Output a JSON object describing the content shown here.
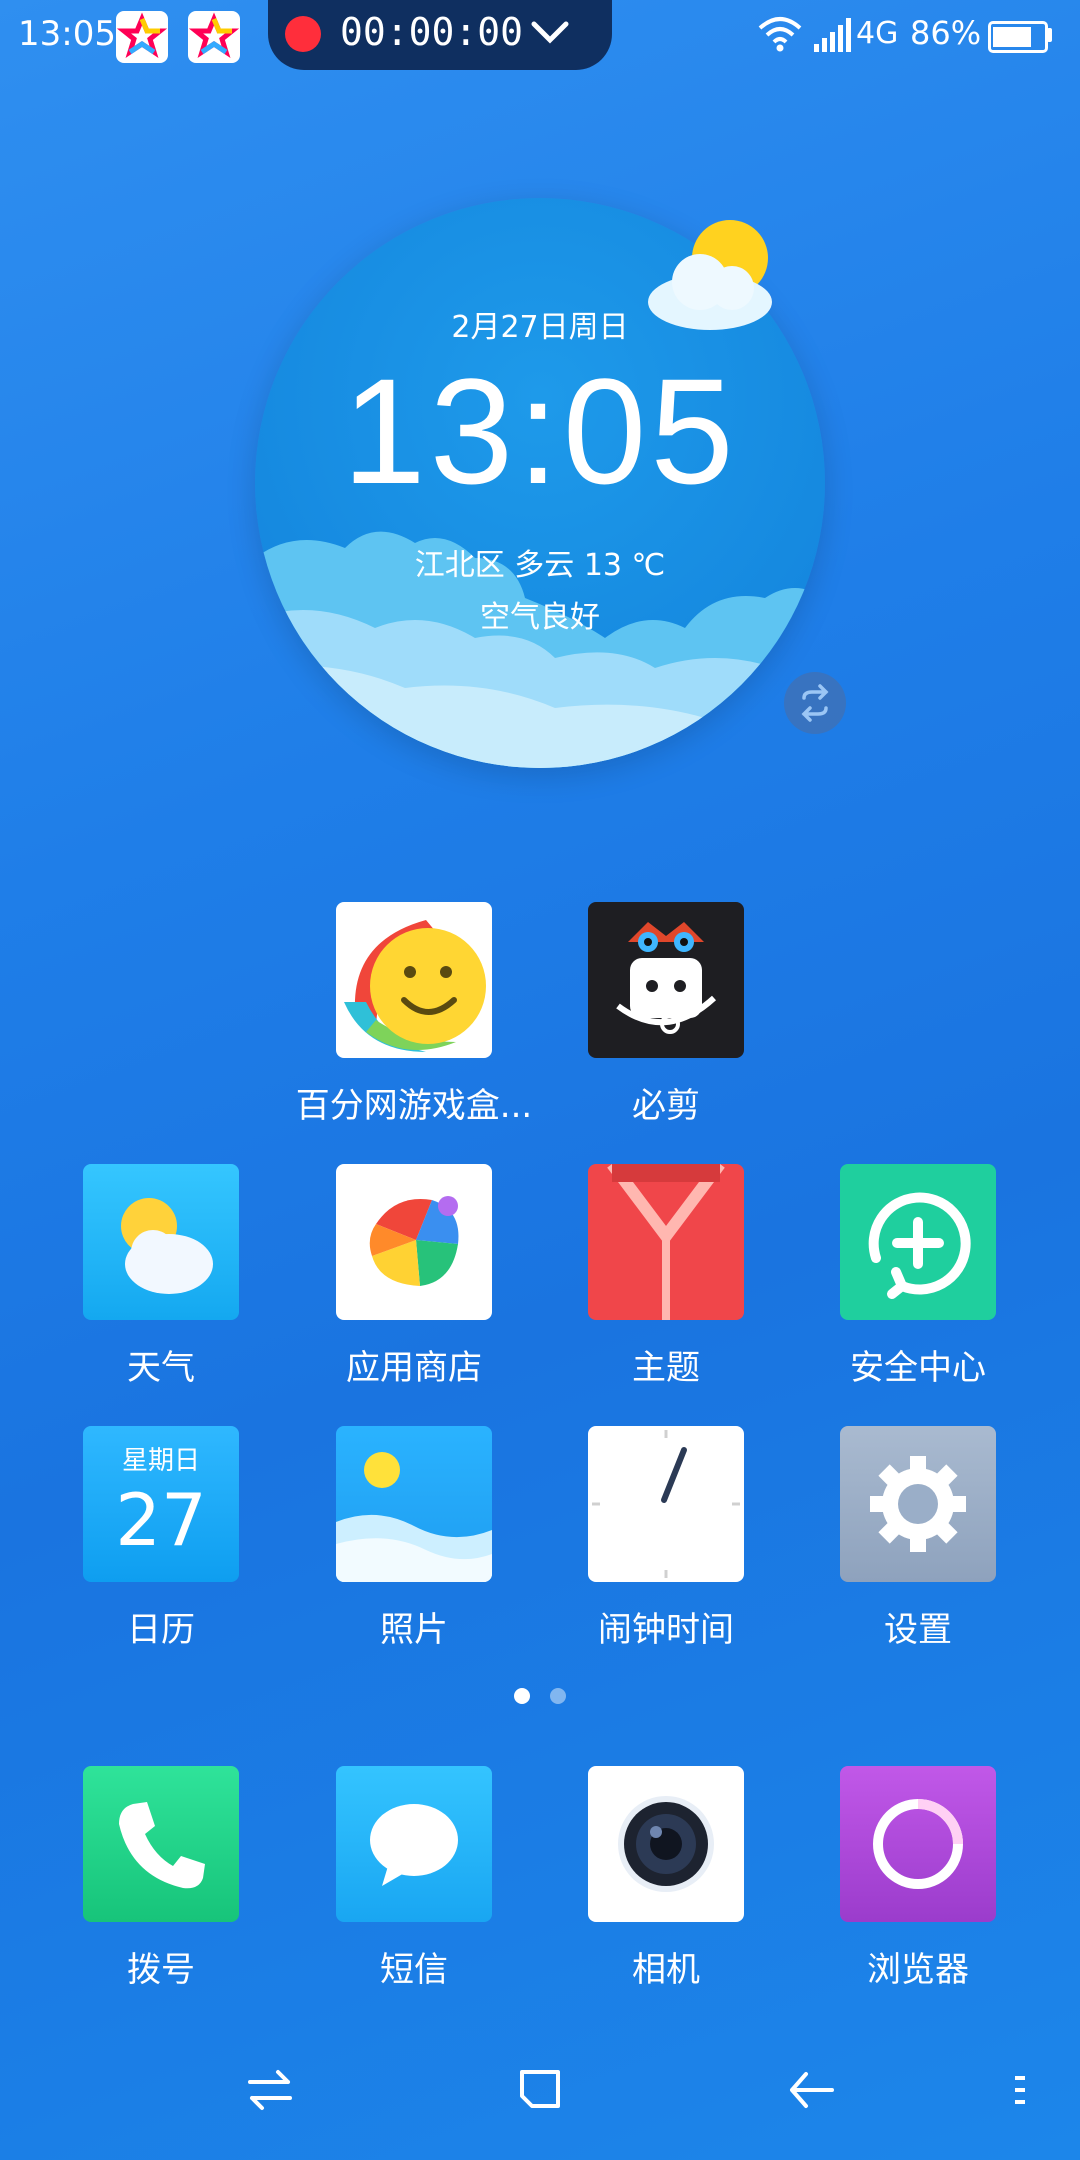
{
  "status_bar": {
    "time": "13:05",
    "record_timer": "00:00:00",
    "network": "4G",
    "battery": "86%",
    "battery_level": 0.86
  },
  "clock_widget": {
    "date": "2月27日周日",
    "time": "13:05",
    "weather": "江北区 多云 13 ℃",
    "air": "空气良好"
  },
  "apps": {
    "row1": [
      {
        "label": "百分网游戏盒...",
        "icon": "baifen-game-box-icon"
      },
      {
        "label": "必剪",
        "icon": "bijian-icon"
      }
    ],
    "row2": [
      {
        "label": "天气",
        "icon": "weather-icon"
      },
      {
        "label": "应用商店",
        "icon": "app-store-icon"
      },
      {
        "label": "主题",
        "icon": "theme-icon"
      },
      {
        "label": "安全中心",
        "icon": "security-center-icon"
      }
    ],
    "row3": [
      {
        "label": "日历",
        "icon": "calendar-icon",
        "weekday": "星期日",
        "day": "27"
      },
      {
        "label": "照片",
        "icon": "photos-icon"
      },
      {
        "label": "闹钟时间",
        "icon": "clock-icon"
      },
      {
        "label": "设置",
        "icon": "settings-icon"
      }
    ],
    "dock": [
      {
        "label": "拨号",
        "icon": "phone-icon"
      },
      {
        "label": "短信",
        "icon": "messages-icon"
      },
      {
        "label": "相机",
        "icon": "camera-icon"
      },
      {
        "label": "浏览器",
        "icon": "browser-icon"
      }
    ]
  },
  "colors": {
    "background": "#1f7ee8",
    "record_red": "#ff2e3b",
    "security_green": "#1fcf9e",
    "theme_red": "#f0464a",
    "browser_purple": "#b048dc"
  }
}
